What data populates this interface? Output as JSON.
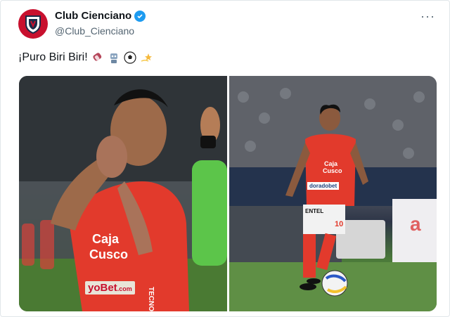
{
  "account": {
    "name": "Club Cienciano",
    "handle": "@Club_Cienciano",
    "verified": true,
    "avatar_icon": "club-crest-icon"
  },
  "menu_icon": "more-options-icon",
  "post": {
    "text": "¡Puro Biri Biri!",
    "emojis": [
      "popsicle-icon",
      "robot-icon",
      "soccer-ball-icon",
      "dizzy-star-icon"
    ]
  },
  "media": {
    "photo1": {
      "jersey_sponsor_1": "Caja",
      "jersey_sponsor_2": "Cusco",
      "jersey_sponsor_3": "yoBet",
      "jersey_sponsor_3b": ".com",
      "jersey_side": "TECNO"
    },
    "photo2": {
      "jersey_sponsor_1": "Caja",
      "jersey_sponsor_2": "Cusco",
      "jersey_sponsor_3": "doradobet",
      "shorts_brand": "ENTEL",
      "shorts_number": "10",
      "billboard": "a"
    }
  },
  "colors": {
    "brand_red": "#c8102e",
    "verified_blue": "#1d9bf0",
    "muted": "#536471"
  }
}
